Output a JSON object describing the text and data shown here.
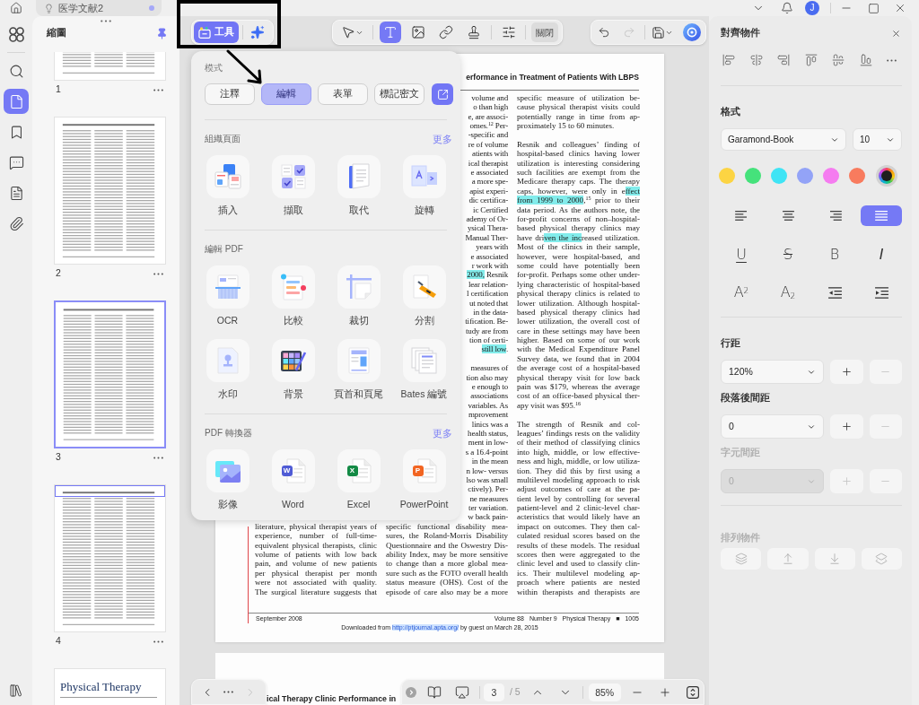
{
  "window": {
    "tab": {
      "title": "医学文献2",
      "unsaved": true
    },
    "user_initial": "J"
  },
  "rail": {
    "items": [
      {
        "kind": "apps",
        "selected": false
      },
      {
        "kind": "search",
        "selected": false
      },
      {
        "kind": "pages",
        "selected": true
      },
      {
        "kind": "bookmarks",
        "selected": false
      },
      {
        "kind": "comments",
        "selected": false
      },
      {
        "kind": "forms",
        "selected": false
      },
      {
        "kind": "attachments",
        "selected": false
      }
    ]
  },
  "thumbnails": {
    "title": "縮圖",
    "pinned": true,
    "pages": [
      {
        "number": "1",
        "selected": false,
        "viewport_marker": false
      },
      {
        "number": "2",
        "selected": false,
        "viewport_marker": false
      },
      {
        "number": "3",
        "selected": true,
        "viewport_marker": false
      },
      {
        "number": "4",
        "selected": false,
        "viewport_marker": true
      },
      {
        "logo": "Physical Therapy",
        "selected": false,
        "viewport_marker": false
      }
    ]
  },
  "toolbar": {
    "tools_button": {
      "label": "工具",
      "selected": true
    },
    "edit_tools": [
      {
        "kind": "select",
        "selected": false
      },
      {
        "kind": "text",
        "selected": true
      },
      {
        "kind": "image",
        "selected": false
      },
      {
        "kind": "link",
        "selected": false
      },
      {
        "kind": "stamp",
        "selected": false
      },
      {
        "kind": "properties",
        "selected": false
      }
    ],
    "close_button": "關閉",
    "undo_disabled": false,
    "redo_disabled": true
  },
  "mode_popup": {
    "mode_label": "模式",
    "modes": [
      {
        "label": "注釋",
        "selected": false
      },
      {
        "label": "編輯",
        "selected": true
      },
      {
        "label": "表單",
        "selected": false
      },
      {
        "label": "標記密文",
        "selected": false
      }
    ],
    "sections": [
      {
        "title": "組織頁面",
        "more": "更多",
        "items": [
          {
            "kind": "insert",
            "label": "插入"
          },
          {
            "kind": "extract",
            "label": "擷取"
          },
          {
            "kind": "replace",
            "label": "取代"
          },
          {
            "kind": "rotate",
            "label": "旋轉"
          }
        ]
      },
      {
        "title": "編輯 PDF",
        "items": [
          {
            "kind": "ocr",
            "label": "OCR"
          },
          {
            "kind": "compare",
            "label": "比較"
          },
          {
            "kind": "crop",
            "label": "裁切"
          },
          {
            "kind": "split",
            "label": "分割"
          },
          {
            "kind": "watermark",
            "label": "水印"
          },
          {
            "kind": "background",
            "label": "背景"
          },
          {
            "kind": "header_footer",
            "label": "頁首和頁尾"
          },
          {
            "kind": "bates",
            "label": "Bates 編號"
          }
        ]
      },
      {
        "title": "PDF 轉換器",
        "more": "更多",
        "items": [
          {
            "kind": "image",
            "label": "影像"
          },
          {
            "kind": "word",
            "label": "Word",
            "badge": "W"
          },
          {
            "kind": "excel",
            "label": "Excel",
            "badge": "X"
          },
          {
            "kind": "powerpoint",
            "label": "PowerPoint",
            "badge": "P"
          }
        ]
      }
    ]
  },
  "document": {
    "running_head": "erformance in Treatment of Patients With LBPS",
    "columns": [
      {
        "paragraphs": [
          {
            "clipped": false,
            "space_before": false,
            "runs_on": true,
            "lines": [
              "literature, physical therapist years of",
              "experience, number of full-time-",
              "equivalent physical therapists, clinic",
              "volume of patients with low back",
              "pain, and volume of new patients",
              "per physical therapist per month",
              "were not associated with quality.",
              "The surgical literature suggests that"
            ]
          }
        ]
      },
      {
        "paragraphs": [
          {
            "clipped": true,
            "space_before": false,
            "lines": [
              "volume and",
              "o than high",
              "e, are associ-",
              "omes.$^{12}$ Per-",
              "-specific and",
              "re of volume",
              "atients with",
              "ical therapist",
              "e associated",
              "a more spe-",
              "apist experi-",
              "dic certifica-",
              "ic Certified",
              "ademy of Or-",
              "ysical Thera-",
              "Manual Ther-",
              "years with",
              "e associated",
              "r work with",
              {
                "parts": [
                  {
                    "text": "2000,",
                    "highlighted": true
                  },
                  {
                    "text": " Resnik",
                    "highlighted": false
                  }
                ]
              },
              "lear relation-",
              "l certification",
              "ut noted that",
              "in the data-",
              "tification. Be-",
              "tudy are from",
              "tion of certi-",
              {
                "parts": [
                  {
                    "text": "still low",
                    "highlighted": true
                  },
                  {
                    "text": ".",
                    "highlighted": false
                  }
                ]
              }
            ]
          },
          {
            "clipped": true,
            "space_before": true,
            "lines": [
              "measures of",
              "tion also may",
              "e enough to",
              "associations",
              "variables. As",
              "mprovement",
              "linics was a",
              "health status,",
              "ment in low-",
              "s a 16.4-point",
              "in the mean",
              "n low- versus",
              "lso was small",
              "ctively). Per-",
              "ne measures",
              "ter variation.",
              "w back pain-"
            ]
          },
          {
            "clipped": false,
            "space_before": false,
            "runs_on": true,
            "lines": [
              "specific functional disability mea-",
              "sures, the Roland-Morris Disability",
              "Questionnaire and the Oswestry Dis-",
              "ability Index, may be more sensitive",
              "to change than a more global mea-",
              "sure such as the FOTO overall health",
              "status measure (OHS). Cost of the",
              "episode of care also may be a more"
            ]
          }
        ]
      },
      {
        "paragraphs": [
          {
            "clipped": false,
            "space_before": false,
            "runs_on": false,
            "lines": [
              "specific measure of utilization be-",
              "cause physical therapist visits could",
              "potentially range in time from ap-",
              "proximately 15 to 60 minutes."
            ]
          },
          {
            "clipped": false,
            "space_before": true,
            "runs_on": false,
            "lines": [
              "Resnik and colleagues’ finding of",
              "hospital-based clinics having lower",
              "utilization is interesting considering",
              "such facilities are exempt from the",
              "Medicare therapy caps. The therapy",
              {
                "parts": [
                  {
                    "text": "caps, however, were only in e",
                    "highlighted": false
                  },
                  {
                    "text": "ffect",
                    "highlighted": true
                  }
                ]
              },
              {
                "parts": [
                  {
                    "text": "from 1999 to 2000",
                    "highlighted": true
                  },
                  {
                    "text": ",$^{15}$ prior to their",
                    "highlighted": false
                  }
                ]
              },
              "data period. As the authors note, the",
              "for-profit concerns of non–hospital-",
              "based physical therapy clinics may",
              {
                "parts": [
                  {
                    "text": "have dri",
                    "highlighted": false
                  },
                  {
                    "text": "ven the inc",
                    "highlighted": true
                  },
                  {
                    "text": "reased utilization.",
                    "highlighted": false
                  }
                ]
              },
              "Most of the clinics in their sample,",
              "however, were hospital-based, and",
              "some could have potentially been",
              "for-profit. Perhaps some other under-",
              "lying characteristic of hospital-based",
              "physical therapy clinics is related to",
              "lower utilization. Although hospital-",
              "based physical therapy clinics had",
              "lower utilization, the overall cost of",
              "care in these settings may have been",
              "higher. Based on some of our work",
              "with the Medical Expenditure Panel",
              "Survey data, we found that in 2004",
              "the average cost of a hospital-based",
              "physical therapy visit for low back",
              "pain was $179, whereas the average",
              "cost of an office-based physical ther-",
              "apy visit was $95.$^{16}$"
            ]
          },
          {
            "clipped": false,
            "space_before": true,
            "runs_on": true,
            "lines": [
              "The strength of Resnik and col-",
              "leagues’ findings rests on the validity",
              "of their method of classifying clinics",
              "into high, middle, or low effective-",
              "ness and high, middle, or low utiliza-",
              "tion. They did this by first using a",
              "multilevel modeling approach to risk",
              "adjust outcomes of care at the pa-",
              "tient level by controlling for several",
              "patient-level and 2 clinic-level char-",
              "acteristics that would likely have an",
              "impact on outcomes. They then cal-",
              "culated residual scores based on the",
              "results of these models. The residual",
              "scores then were aggregated to the",
              "clinic level and used to classify clin-",
              "ics. Their multilevel modeling ap-",
              "proach where patients are nested",
              "within therapists and therapists are"
            ]
          }
        ]
      }
    ],
    "footer": {
      "date": "September 2008",
      "issue": [
        "Volume 88",
        "Number 9",
        "Physical Therapy",
        "■",
        "1005"
      ],
      "download_note": {
        "before": "Downloaded from",
        "link": "http://ptjournal.apta.org/",
        "after": "by guest on March 28, 2015"
      }
    },
    "next_page_heading": "ical Therapy Clinic Performance in"
  },
  "page_nav": {
    "back_disabled": false,
    "forward_disabled": true,
    "page": "3",
    "total": "/ 5",
    "zoom": "85%"
  },
  "properties": {
    "title": "對齊物件",
    "format_title": "格式",
    "font": "Garamond-Book",
    "font_size": "10",
    "swatches": [
      {
        "kind": "preset",
        "color": "#fcd443",
        "selected": false
      },
      {
        "kind": "preset",
        "color": "#45e27b",
        "selected": false
      },
      {
        "kind": "preset",
        "color": "#3fe4f5",
        "selected": false
      },
      {
        "kind": "preset",
        "color": "#93a3f7",
        "selected": false
      },
      {
        "kind": "preset",
        "color": "#f57cf0",
        "selected": false
      },
      {
        "kind": "preset",
        "color": "#f87b5e",
        "selected": false
      },
      {
        "kind": "custom",
        "color": "#1f1f1f",
        "selected": true
      }
    ],
    "alignment": [
      {
        "kind": "left",
        "selected": false
      },
      {
        "kind": "center",
        "selected": false
      },
      {
        "kind": "right",
        "selected": false
      },
      {
        "kind": "justify",
        "selected": true
      }
    ],
    "styles": [
      {
        "kind": "underline",
        "label": "U"
      },
      {
        "kind": "strikethrough",
        "label": "S"
      },
      {
        "kind": "bold",
        "label": "B"
      },
      {
        "kind": "italic",
        "label": "I"
      },
      {
        "kind": "superscript",
        "label": "A$^{2}$"
      },
      {
        "kind": "subscript",
        "label": "A$_{2}$"
      },
      {
        "kind": "outdent"
      },
      {
        "kind": "indent"
      }
    ],
    "spacing": [
      {
        "label": "行距",
        "value": "120%",
        "disabled": false,
        "plus_disabled": false,
        "minus_disabled": true
      },
      {
        "label": "段落後間距",
        "value": "0",
        "disabled": false,
        "plus_disabled": false,
        "minus_disabled": true
      },
      {
        "label": "字元間距",
        "value": "0",
        "disabled": true,
        "plus_disabled": true,
        "minus_disabled": true
      }
    ],
    "arrange": {
      "title": "排列物件",
      "disabled": true
    }
  }
}
